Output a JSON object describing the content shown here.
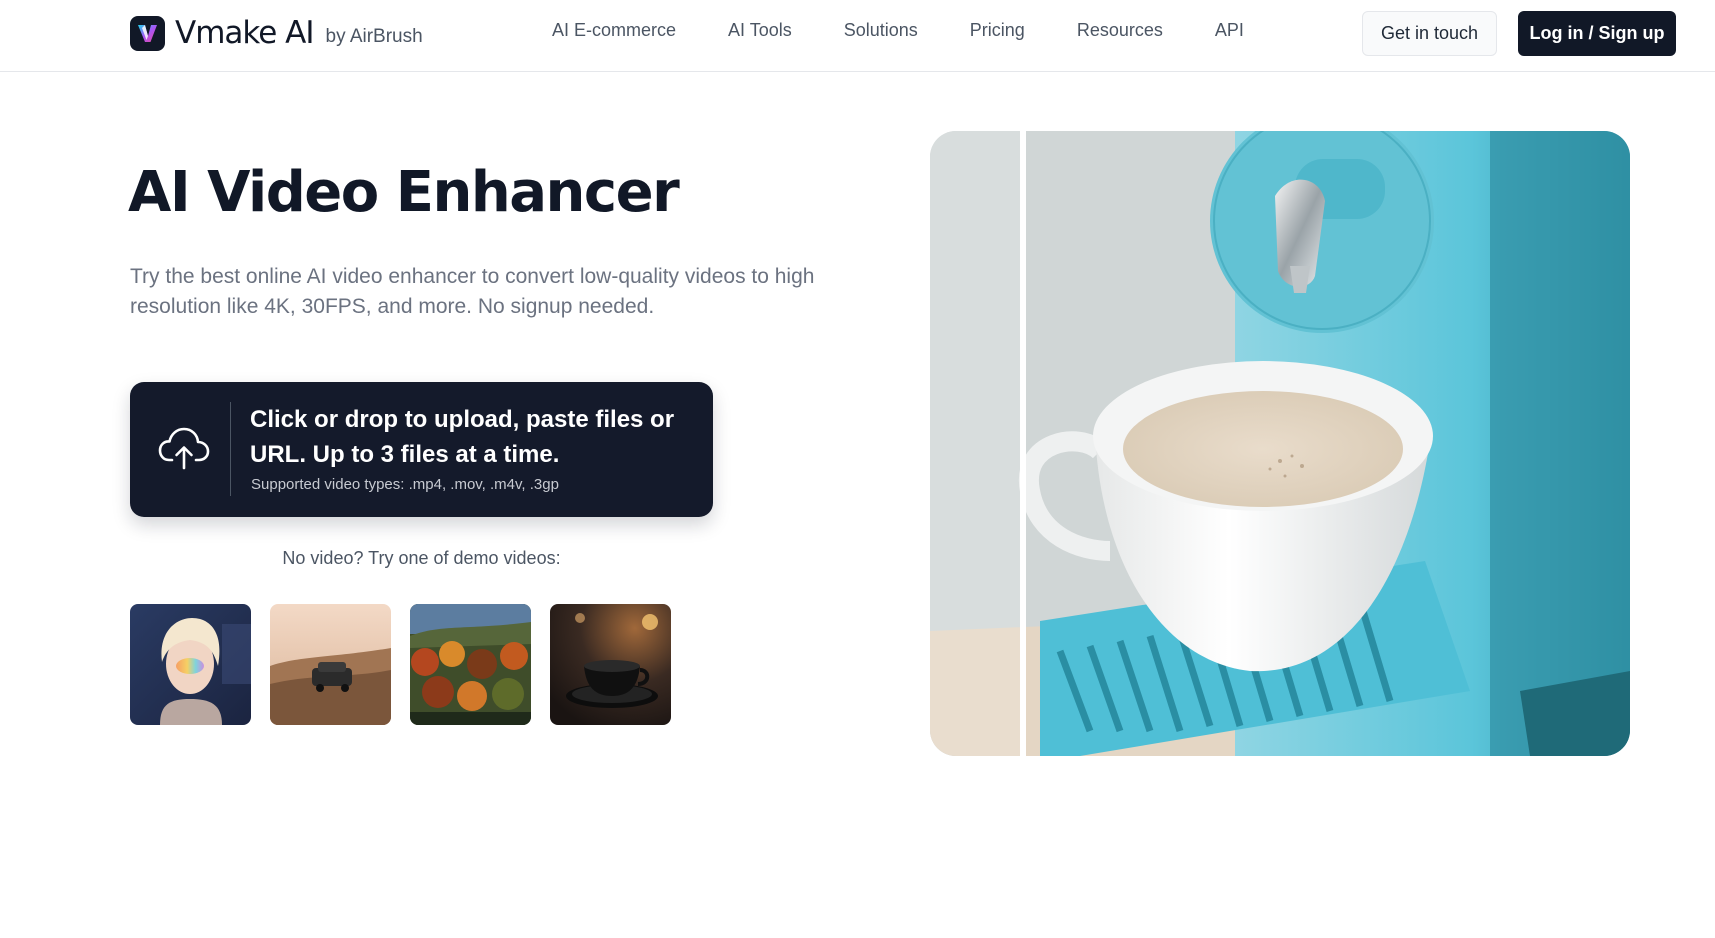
{
  "header": {
    "brand": "Vmake AI",
    "brand_by": "by AirBrush",
    "nav": [
      "AI E-commerce",
      "AI Tools",
      "Solutions",
      "Pricing",
      "Resources",
      "API"
    ],
    "contact_label": "Get in touch",
    "login_label": "Log in / Sign up"
  },
  "hero": {
    "title": "AI Video Enhancer",
    "subtitle": "Try the best online AI video enhancer to convert low-quality videos to high resolution like 4K, 30FPS, and more. No signup needed.",
    "upload": {
      "icon": "cloud-upload-icon",
      "main_text": "Click or drop to upload, paste files or URL. Up to 3 files at a time.",
      "types_text": "Supported video types: .mp4, .mov, .m4v, .3gp"
    },
    "demo_label": "No video? Try one of demo videos:",
    "demo_videos": [
      "woman-portrait",
      "car-in-desert",
      "autumn-forest",
      "coffee-cup"
    ]
  },
  "compare_image": "coffee-machine-before-after",
  "colors": {
    "primary_dark": "#111827",
    "upload_bg": "#141a2b",
    "text_muted": "#6b7280",
    "machine_teal": "#5bc5da"
  }
}
